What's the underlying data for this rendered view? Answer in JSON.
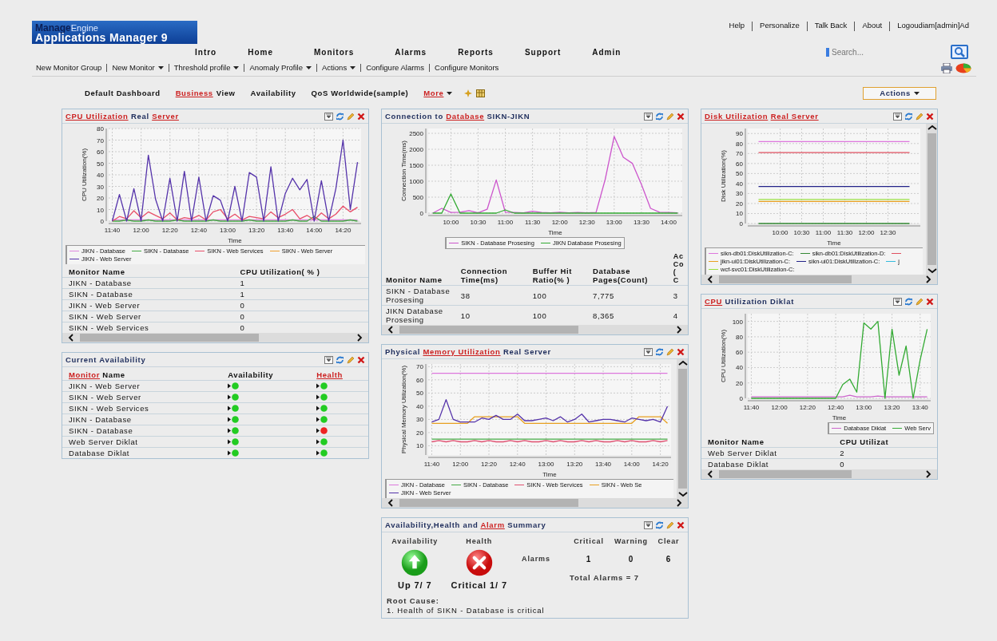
{
  "header": {
    "logo": {
      "brand": "Manage",
      "brand_sub": "Engine",
      "product": "Applications Manager 9"
    },
    "top_links": [
      "Help",
      "Personalize",
      "Talk Back",
      "About",
      "Logoudiam[admin]Ad"
    ],
    "nav": [
      "Intro",
      "Home",
      "Monitors",
      "Alarms",
      "Reports",
      "Support",
      "Admin"
    ],
    "search": {
      "placeholder": "Search..."
    },
    "submenu": [
      {
        "label": "New Monitor Group",
        "dropdown": false
      },
      {
        "label": "New Monitor",
        "dropdown": true
      },
      {
        "label": "Threshold profile",
        "dropdown": true
      },
      {
        "label": "Anomaly Profile",
        "dropdown": true
      },
      {
        "label": "Actions",
        "dropdown": true
      },
      {
        "label": "Configure Alarms",
        "dropdown": false
      },
      {
        "label": "Configure Monitors",
        "dropdown": false
      }
    ]
  },
  "dashboard_tabs": [
    {
      "parts": [
        {
          "text": "Default Dashboard",
          "kind": "text"
        }
      ],
      "dropdown": false
    },
    {
      "parts": [
        {
          "text": "Business",
          "kind": "link"
        },
        {
          "text": "View",
          "kind": "text"
        }
      ],
      "dropdown": false
    },
    {
      "parts": [
        {
          "text": "Availability",
          "kind": "text"
        }
      ],
      "dropdown": false
    },
    {
      "parts": [
        {
          "text": "QoS Worldwide(sample)",
          "kind": "text"
        }
      ],
      "dropdown": false
    },
    {
      "parts": [
        {
          "text": "More",
          "kind": "link"
        }
      ],
      "dropdown": true
    }
  ],
  "actions_button": {
    "label": "Actions",
    "dropdown": true
  },
  "columns": [
    {
      "panels": [
        {
          "title": [
            {
              "text": "CPU Utilization",
              "kind": "link"
            },
            {
              "text": "Real",
              "kind": "text"
            },
            {
              "text": "Server",
              "kind": "link"
            }
          ],
          "hscroll": true,
          "vscroll": false,
          "chart_data": {
            "type": "line",
            "grid": true,
            "xlabel": "Time",
            "ylabel": "CPU Utilization(%)",
            "ylim": [
              0,
              80
            ],
            "yticks": [
              0,
              10,
              20,
              30,
              40,
              50,
              60,
              70,
              80
            ],
            "categories": [
              "11:40",
              null,
              null,
              null,
              "12:00",
              null,
              null,
              null,
              "12:20",
              null,
              null,
              null,
              "12:40",
              null,
              null,
              null,
              "13:00",
              null,
              null,
              null,
              "13:20",
              null,
              null,
              null,
              "13:40",
              null,
              null,
              null,
              "14:00",
              null,
              null,
              null,
              "14:20",
              null,
              null
            ],
            "series": [
              {
                "name": "JIKN - Database",
                "color": "#dd88dd",
                "values": [
                  1,
                  1,
                  1,
                  1,
                  1,
                  1,
                  1,
                  1,
                  1,
                  1,
                  1,
                  1,
                  1,
                  1,
                  1,
                  1,
                  1,
                  1,
                  1,
                  1,
                  1,
                  1,
                  1,
                  1,
                  1,
                  1,
                  1,
                  1,
                  1,
                  1,
                  1,
                  1,
                  1,
                  1,
                  1
                ]
              },
              {
                "name": "SIKN - Database",
                "color": "#44aa44",
                "values": [
                  0,
                  0,
                  1,
                  0,
                  0,
                  1,
                  0,
                  0,
                  0,
                  1,
                  0,
                  0,
                  0,
                  0,
                  1,
                  0,
                  0,
                  0,
                  0,
                  1,
                  0,
                  0,
                  0,
                  0,
                  0,
                  1,
                  0,
                  0,
                  4,
                  0,
                  0,
                  0,
                  0,
                  1,
                  0
                ]
              },
              {
                "name": "SIKN - Web Services",
                "color": "#e8506a",
                "values": [
                  0,
                  4,
                  2,
                  9,
                  3,
                  8,
                  5,
                  2,
                  7,
                  1,
                  3,
                  2,
                  5,
                  1,
                  8,
                  10,
                  2,
                  6,
                  1,
                  4,
                  3,
                  2,
                  8,
                  3,
                  6,
                  10,
                  2,
                  5,
                  1,
                  7,
                  2,
                  6,
                  13,
                  8,
                  12
                ]
              },
              {
                "name": "SIKN - Web Server",
                "color": "#f0a030",
                "values": [
                  null,
                  null,
                  null,
                  null,
                  null,
                  null,
                  null,
                  null,
                  null,
                  null,
                  null,
                  null,
                  null,
                  null,
                  null,
                  null,
                  null,
                  null,
                  null,
                  null,
                  null,
                  null,
                  null,
                  null,
                  null,
                  null,
                  null,
                  null,
                  null,
                  null,
                  null,
                  null,
                  null,
                  null,
                  null
                ]
              },
              {
                "name": "JIKN - Web Server",
                "color": "#5533aa",
                "values": [
                  0,
                  23,
                  0,
                  28,
                  0,
                  57,
                  19,
                  0,
                  37,
                  0,
                  43,
                  0,
                  38,
                  0,
                  22,
                  18,
                  0,
                  30,
                  0,
                  42,
                  38,
                  0,
                  47,
                  0,
                  24,
                  37,
                  27,
                  36,
                  0,
                  35,
                  0,
                  28,
                  70,
                  10,
                  51
                ]
              }
            ]
          },
          "table": {
            "columns": [
              "Monitor Name",
              "CPU Utilization( % )"
            ],
            "rows": [
              [
                "JIKN - Database",
                "1"
              ],
              [
                "SIKN - Database",
                "1"
              ],
              [
                "JIKN - Web Server",
                "0"
              ],
              [
                "SIKN - Web Server",
                "0"
              ],
              [
                "SIKN - Web Services",
                "0"
              ]
            ]
          }
        },
        {
          "title": [
            {
              "text": "Current Availability",
              "kind": "text"
            }
          ],
          "hscroll": false,
          "vscroll": false,
          "availability_table": {
            "columns": [
              {
                "parts": [
                  {
                    "text": "Monitor",
                    "kind": "link"
                  },
                  {
                    "text": "Name",
                    "kind": "text"
                  }
                ]
              },
              {
                "parts": [
                  {
                    "text": "Availability",
                    "kind": "text"
                  }
                ]
              },
              {
                "parts": [
                  {
                    "text": "Health",
                    "kind": "link"
                  }
                ]
              }
            ],
            "rows": [
              {
                "name": "JIKN - Web Server",
                "availability": {
                  "color": "#22cc22"
                },
                "health": {
                  "color": "#22cc22"
                }
              },
              {
                "name": "SIKN - Web Server",
                "availability": {
                  "color": "#22cc22"
                },
                "health": {
                  "color": "#22cc22"
                }
              },
              {
                "name": "SIKN - Web Services",
                "availability": {
                  "color": "#22cc22"
                },
                "health": {
                  "color": "#22cc22"
                }
              },
              {
                "name": "JIKN - Database",
                "availability": {
                  "color": "#22cc22"
                },
                "health": {
                  "color": "#22cc22"
                }
              },
              {
                "name": "SIKN - Database",
                "availability": {
                  "color": "#22cc22"
                },
                "health": {
                  "color": "#ee2222"
                }
              },
              {
                "name": "Web Server Diklat",
                "availability": {
                  "color": "#22cc22"
                },
                "health": {
                  "color": "#22cc22"
                }
              },
              {
                "name": "Database Diklat",
                "availability": {
                  "color": "#22cc22"
                },
                "health": {
                  "color": "#22cc22"
                }
              }
            ]
          }
        }
      ]
    },
    {
      "panels": [
        {
          "title": [
            {
              "text": "Connection to",
              "kind": "text"
            },
            {
              "text": "Database",
              "kind": "link"
            },
            {
              "text": "SIKN-JIKN",
              "kind": "text"
            }
          ],
          "hscroll": true,
          "vscroll": false,
          "chart_data": {
            "type": "line",
            "grid": true,
            "xlabel": "Time",
            "ylabel": "Connection Time(ms)",
            "ylim": [
              0,
              2650
            ],
            "yticks": [
              0,
              500,
              1000,
              1500,
              2000,
              2500
            ],
            "categories": [
              null,
              null,
              "10:00",
              null,
              null,
              "10:30",
              null,
              null,
              "11:00",
              null,
              null,
              "11:30",
              null,
              null,
              "12:00",
              null,
              null,
              "12:30",
              null,
              null,
              "13:00",
              null,
              null,
              "13:30",
              null,
              null,
              "14:00",
              null
            ],
            "series": [
              {
                "name": "SIKN - Database Prosesing",
                "color": "#cc55cc",
                "values": [
                  0,
                  150,
                  20,
                  30,
                  80,
                  10,
                  120,
                  1040,
                  30,
                  20,
                  10,
                  60,
                  20,
                  10,
                  30,
                  10,
                  20,
                  10,
                  20,
                  1050,
                  2400,
                  1750,
                  1560,
                  900,
                  150,
                  30,
                  20,
                  10
                ]
              },
              {
                "name": "JIKN Database Prosesing",
                "color": "#33aa33",
                "values": [
                  0,
                  0,
                  600,
                  0,
                  0,
                  0,
                  0,
                  0,
                  100,
                  0,
                  0,
                  0,
                  0,
                  0,
                  0,
                  0,
                  0,
                  0,
                  0,
                  0,
                  0,
                  0,
                  0,
                  0,
                  0,
                  0,
                  0,
                  0
                ]
              }
            ]
          },
          "table": {
            "columns": [
              "Monitor Name",
              "Connection Time(ms)",
              "Buffer Hit Ratio(% )",
              "Database Pages(Count)",
              "Ac Co ( C"
            ],
            "rows": [
              [
                "SIKN - Database Prosesing",
                "38",
                "100",
                "7,775",
                "3"
              ],
              [
                "JIKN Database Prosesing",
                "10",
                "100",
                "8,365",
                "4"
              ]
            ]
          }
        },
        {
          "title": [
            {
              "text": "Physical",
              "kind": "text"
            },
            {
              "text": "Memory Utilization",
              "kind": "link"
            },
            {
              "text": "Real Server",
              "kind": "text"
            }
          ],
          "hscroll": true,
          "vscroll": true,
          "chart_data": {
            "type": "line",
            "grid": true,
            "xlabel": "Time",
            "ylabel": "Physical Memory Utilization(%)",
            "ylim": [
              3,
              72
            ],
            "yticks": [
              10,
              20,
              30,
              40,
              50,
              60,
              70
            ],
            "categories": [
              "11:40",
              null,
              null,
              null,
              "12:00",
              null,
              null,
              null,
              "12:20",
              null,
              null,
              null,
              "12:40",
              null,
              null,
              null,
              "13:00",
              null,
              null,
              null,
              "13:20",
              null,
              null,
              null,
              "13:40",
              null,
              null,
              null,
              "14:00",
              null,
              null,
              null,
              "14:20",
              null
            ],
            "series": [
              {
                "name": "JIKN - Database",
                "color": "#dd77dd",
                "values": [
                  65,
                  65,
                  65,
                  65,
                  65,
                  65,
                  65,
                  65,
                  65,
                  65,
                  65,
                  65,
                  65,
                  65,
                  65,
                  65,
                  65,
                  65,
                  65,
                  65,
                  65,
                  65,
                  65,
                  65,
                  65,
                  65,
                  65,
                  65,
                  65,
                  65,
                  65,
                  65,
                  65,
                  65
                ]
              },
              {
                "name": "SIKN - Database",
                "color": "#44aa44",
                "values": [
                  15,
                  15,
                  15,
                  15,
                  15,
                  15,
                  15,
                  15,
                  15,
                  15,
                  15,
                  15,
                  15,
                  15,
                  15,
                  15,
                  15,
                  15,
                  15,
                  15,
                  15,
                  15,
                  15,
                  15,
                  15,
                  15,
                  15,
                  15,
                  15,
                  15,
                  15,
                  15,
                  15,
                  15
                ]
              },
              {
                "name": "SIKN - Web Services",
                "color": "#e05070",
                "values": [
                  13,
                  14,
                  13,
                  14,
                  13,
                  13,
                  14,
                  13,
                  14,
                  13,
                  13,
                  14,
                  13,
                  14,
                  13,
                  13,
                  14,
                  13,
                  14,
                  13,
                  13,
                  14,
                  13,
                  14,
                  13,
                  13,
                  14,
                  13,
                  14,
                  13,
                  13,
                  14,
                  13,
                  14
                ]
              },
              {
                "name": "SIKN - Web Se",
                "color": "#e8a020",
                "values": [
                  27,
                  27,
                  27,
                  27,
                  27,
                  27,
                  32,
                  32,
                  32,
                  32,
                  32,
                  32,
                  32,
                  27,
                  27,
                  27,
                  27,
                  27,
                  27,
                  27,
                  27,
                  27,
                  27,
                  27,
                  27,
                  27,
                  27,
                  27,
                  27,
                  32,
                  32,
                  32,
                  32,
                  27
                ]
              },
              {
                "name": "JIKN - Web Server",
                "color": "#5533aa",
                "values": [
                  28,
                  30,
                  45,
                  30,
                  28,
                  28,
                  28,
                  31,
                  30,
                  33,
                  30,
                  30,
                  34,
                  29,
                  29,
                  30,
                  31,
                  29,
                  32,
                  28,
                  30,
                  34,
                  28,
                  29,
                  30,
                  30,
                  29,
                  28,
                  31,
                  30,
                  29,
                  30,
                  28,
                  40
                ]
              }
            ]
          }
        },
        {
          "title": [
            {
              "text": "Availability,Health and",
              "kind": "text"
            },
            {
              "text": "Alarm",
              "kind": "link"
            },
            {
              "text": "Summary",
              "kind": "text"
            }
          ],
          "hscroll": false,
          "vscroll": false,
          "summary": {
            "availability": {
              "label": "Availability",
              "kind": "up",
              "text": "Up 7/ 7"
            },
            "health": {
              "label": "Health",
              "kind": "critical",
              "text": "Critical 1/ 7"
            },
            "alarms": {
              "label": "Alarms",
              "columns": [
                "Critical",
                "Warning",
                "Clear"
              ],
              "values": [
                "1",
                "0",
                "6"
              ],
              "total_label": "Total Alarms =",
              "total": "7"
            },
            "root_cause": {
              "label": "Root Cause:",
              "items": [
                "1. Health of SIKN - Database is critical"
              ]
            }
          }
        }
      ]
    },
    {
      "panels": [
        {
          "title": [
            {
              "text": "Disk Utilization",
              "kind": "link"
            },
            {
              "text": "Real Server",
              "kind": "link"
            }
          ],
          "hscroll": true,
          "vscroll": true,
          "chart_data": {
            "type": "line",
            "grid": true,
            "xlabel": "Time",
            "ylabel": "Disk Utilization(%)",
            "ylim": [
              0,
              95
            ],
            "yticks": [
              0,
              10,
              20,
              30,
              40,
              50,
              60,
              70,
              80,
              90
            ],
            "categories": [
              null,
              "10:00",
              "10:30",
              "11:00",
              "11:30",
              "12:00",
              "12:30",
              null
            ],
            "series": [
              {
                "name": "sikn-db01:DiskUtilization-C:",
                "color": "#dd77dd",
                "values": [
                  82,
                  82,
                  82,
                  82,
                  82,
                  82,
                  82,
                  82
                ]
              },
              {
                "name": "sikn-db01:DiskUtilization-D:",
                "color": "#338833",
                "values": [
                  0,
                  0,
                  0,
                  0,
                  0,
                  0,
                  0,
                  0
                ]
              },
              {
                "color": "#e05060",
                "values": [
                  71,
                  71,
                  71,
                  71,
                  71,
                  71,
                  71,
                  71
                ]
              },
              {
                "name": "jikn-ui01:DiskUtilization-C:",
                "color": "#e8a020",
                "values": [
                  22,
                  22,
                  22,
                  22,
                  22,
                  22,
                  22,
                  22
                ]
              },
              {
                "name": "sikn-ui01:DiskUtilization-C:",
                "color": "#222288",
                "values": [
                  37,
                  37,
                  37,
                  37,
                  37,
                  37,
                  37,
                  37
                ]
              },
              {
                "name": "j",
                "color": "#33bbdd",
                "values": [
                  null,
                  null,
                  null,
                  null,
                  null,
                  null,
                  null,
                  null
                ]
              },
              {
                "name": "wcf-svc01:DiskUtilization-C:",
                "color": "#99e040",
                "values": [
                  24,
                  24,
                  24,
                  24,
                  24,
                  24,
                  24,
                  24
                ]
              }
            ]
          }
        },
        {
          "title": [
            {
              "text": "CPU",
              "kind": "link"
            },
            {
              "text": "Utilization Diklat",
              "kind": "text"
            }
          ],
          "hscroll": true,
          "vscroll": false,
          "chart_data": {
            "type": "line",
            "grid": true,
            "xlabel": "Time",
            "ylabel": "CPU Utilization(%)",
            "ylim": [
              0,
              110
            ],
            "yticks": [
              0,
              20,
              40,
              60,
              80,
              100
            ],
            "categories": [
              "11:40",
              null,
              null,
              null,
              "12:00",
              null,
              null,
              null,
              "12:20",
              null,
              null,
              null,
              "12:40",
              null,
              null,
              null,
              "13:00",
              null,
              null,
              null,
              "13:20",
              null,
              null,
              null,
              "13:40",
              null
            ],
            "series": [
              {
                "name": "Database Diklat",
                "color": "#cc66cc",
                "values": [
                  2,
                  2,
                  2,
                  2,
                  2,
                  2,
                  2,
                  2,
                  2,
                  2,
                  2,
                  2,
                  2,
                  2,
                  4,
                  2,
                  2,
                  2,
                  3,
                  2,
                  2,
                  2,
                  2,
                  2,
                  2,
                  2
                ]
              },
              {
                "name": "Web Serv",
                "color": "#33aa33",
                "values": [
                  0,
                  0,
                  0,
                  0,
                  0,
                  0,
                  0,
                  0,
                  0,
                  0,
                  0,
                  0,
                  0,
                  18,
                  25,
                  8,
                  98,
                  90,
                  100,
                  0,
                  90,
                  30,
                  68,
                  0,
                  50,
                  90
                ]
              }
            ]
          },
          "table": {
            "columns": [
              "Monitor Name",
              "CPU Utilizat"
            ],
            "rows": [
              [
                "Web Server Diklat",
                "2"
              ],
              [
                "Database Diklat",
                "0"
              ]
            ]
          }
        }
      ]
    }
  ]
}
